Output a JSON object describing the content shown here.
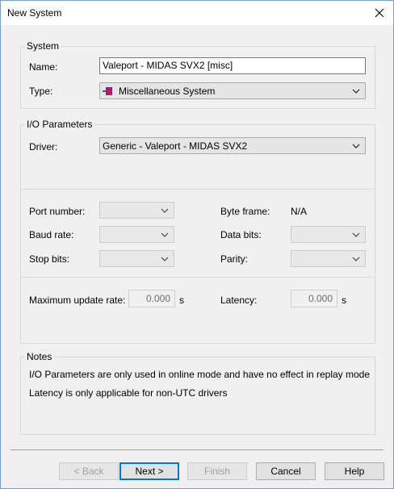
{
  "window": {
    "title": "New System"
  },
  "system": {
    "group_label": "System",
    "name_label": "Name:",
    "name_value": "Valeport - MIDAS SVX2 [misc]",
    "type_label": "Type:",
    "type_value": "Miscellaneous System",
    "type_icon": "misc-system-icon"
  },
  "io": {
    "group_label": "I/O Parameters",
    "driver_label": "Driver:",
    "driver_value": "Generic - Valeport - MIDAS SVX2",
    "port_label": "Port number:",
    "baud_label": "Baud rate:",
    "stop_label": "Stop bits:",
    "byteframe_label": "Byte frame:",
    "byteframe_value": "N/A",
    "databits_label": "Data bits:",
    "parity_label": "Parity:",
    "maxrate_label": "Maximum update rate:",
    "maxrate_value": "0.000",
    "maxrate_unit": "s",
    "latency_label": "Latency:",
    "latency_value": "0.000",
    "latency_unit": "s"
  },
  "notes": {
    "group_label": "Notes",
    "line1": "I/O Parameters are only used in online mode and have no effect in replay mode",
    "line2": "Latency is only applicable for non-UTC drivers"
  },
  "buttons": {
    "back": "< Back",
    "next": "Next >",
    "finish": "Finish",
    "cancel": "Cancel",
    "help": "Help"
  },
  "colors": {
    "accent": "#0078d7",
    "window_border": "#7a9cd3"
  }
}
